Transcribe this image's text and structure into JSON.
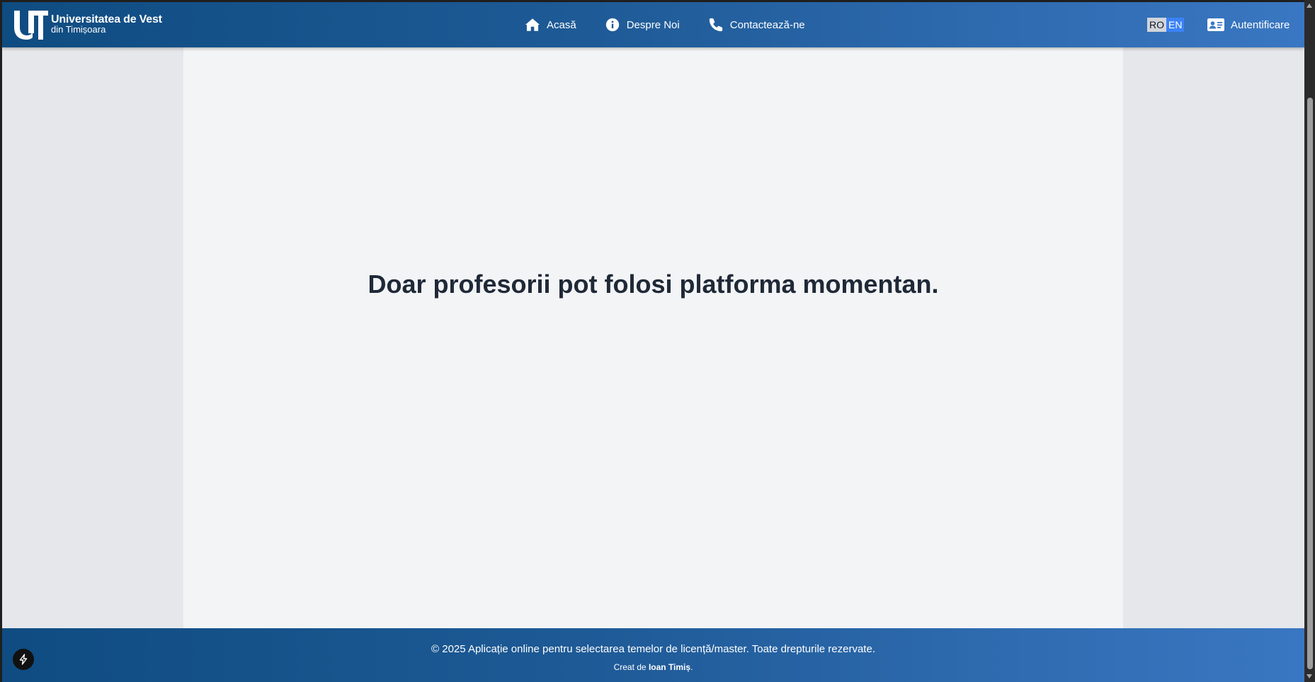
{
  "header": {
    "brand_line1": "Universitatea de Vest",
    "brand_line2": "din Timișoara",
    "nav": [
      {
        "label": "Acasă",
        "icon": "home-icon"
      },
      {
        "label": "Despre Noi",
        "icon": "info-icon"
      },
      {
        "label": "Contactează-ne",
        "icon": "phone-icon"
      }
    ],
    "lang": {
      "ro": "RO",
      "en": "EN",
      "active": "RO"
    },
    "login_label": "Autentificare",
    "login_icon": "id-card-icon"
  },
  "main": {
    "message": "Doar profesorii pot folosi platforma momentan."
  },
  "footer": {
    "copyright": "© 2025 Aplicație online pentru selectarea temelor de licență/master. Toate drepturile rezervate.",
    "credit_prefix": "Creat de ",
    "credit_name": "Ioan Timiș",
    "credit_suffix": "."
  },
  "colors": {
    "header_gradient_start": "#0f4c81",
    "header_gradient_end": "#3a77c2",
    "page_background": "#e5e7eb",
    "content_background": "#f3f4f6",
    "heading_text": "#1f2937",
    "lang_active_bg": "#d1d5db",
    "lang_inactive_bg": "#3b82f6"
  }
}
